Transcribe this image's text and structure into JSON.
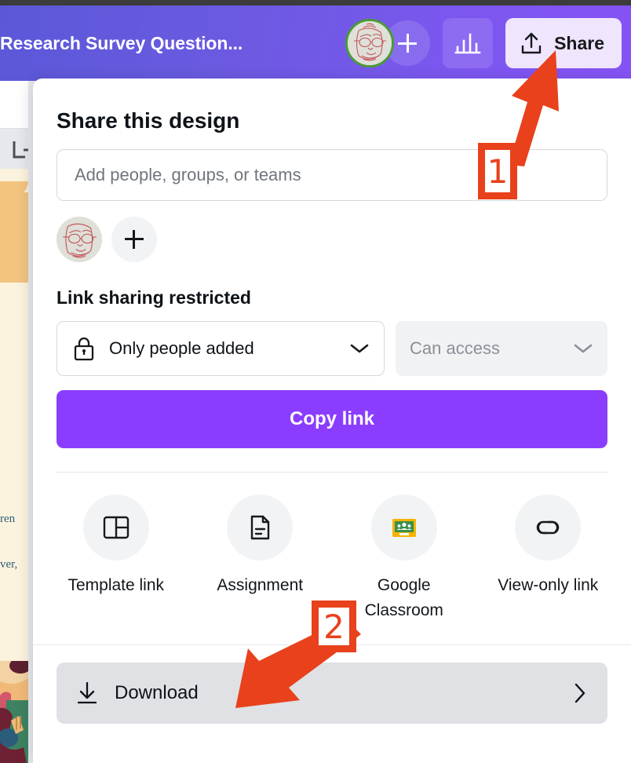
{
  "topbar": {
    "doc_title": "Research Survey Question...",
    "avatar_name": "user-avatar",
    "add_collaborator_label": "+",
    "chart_icon": "bar-chart-icon",
    "share_label": "Share",
    "share_icon": "upload-icon",
    "bar_gradient_from": "#5b58d8",
    "bar_gradient_to": "#8652f4",
    "avatar_ring_color": "#4a9b35",
    "share_button_bg": "#efe5fd"
  },
  "background": {
    "add_page_icon": "add-page-icon",
    "canvas_text_fragment_1": "ren",
    "canvas_text_fragment_2": "ver,"
  },
  "dialog": {
    "title": "Share this design",
    "people_input_placeholder": "Add people, groups, or teams",
    "people_input_value": "",
    "member_avatar": "member-avatar",
    "add_member_label": "+",
    "link_section_title": "Link sharing restricted",
    "permission_select": {
      "icon": "lock-icon",
      "value": "Only people added",
      "chevron": "chevron-down-icon"
    },
    "access_select": {
      "value": "Can access",
      "chevron": "chevron-down-icon"
    },
    "copy_link_label": "Copy link",
    "copy_link_color": "#8b3dff",
    "quick_actions": [
      {
        "icon": "template-layout-icon",
        "label": "Template link"
      },
      {
        "icon": "document-icon",
        "label": "Assignment"
      },
      {
        "icon": "google-classroom-icon",
        "label": "Google Classroom"
      },
      {
        "icon": "link-chain-icon",
        "label": "View-only link"
      }
    ],
    "download": {
      "icon": "download-icon",
      "label": "Download",
      "chevron": "chevron-right-icon"
    }
  },
  "annotations": {
    "marker_color": "#e8411c",
    "steps": [
      {
        "number": "1",
        "target": "share-button"
      },
      {
        "number": "2",
        "target": "download-row"
      }
    ]
  }
}
